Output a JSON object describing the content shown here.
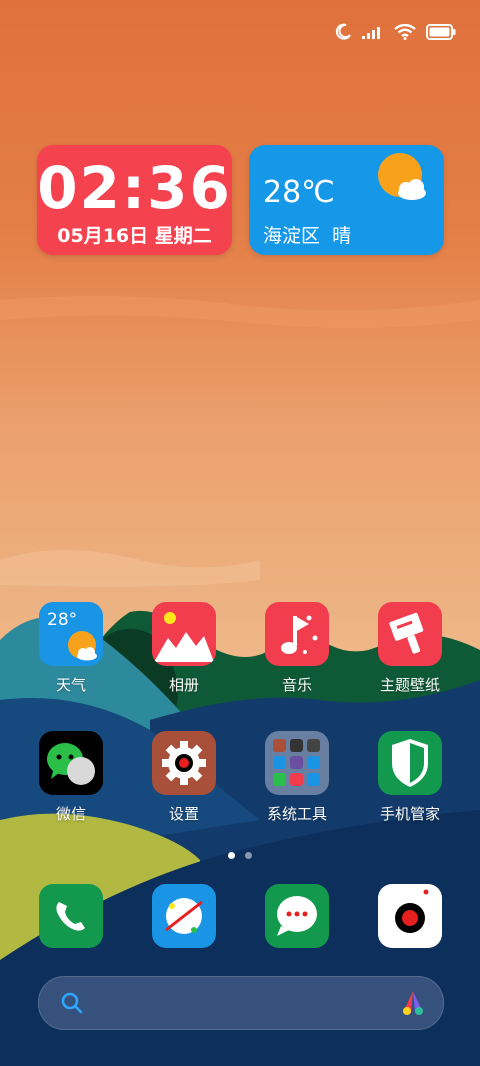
{
  "status_bar": {
    "icons": [
      "moon-icon",
      "signal-icon",
      "wifi-icon",
      "battery-icon"
    ]
  },
  "clock_widget": {
    "time": "02:36",
    "date": "05月16日 星期二"
  },
  "weather_widget": {
    "temperature": "28℃",
    "location": "海淀区",
    "condition": "晴",
    "icon": "sun-cloud-icon"
  },
  "apps": [
    {
      "label": "天气",
      "icon": "weather-app-icon",
      "badge": "28°"
    },
    {
      "label": "相册",
      "icon": "gallery-icon"
    },
    {
      "label": "音乐",
      "icon": "music-icon"
    },
    {
      "label": "主题壁纸",
      "icon": "themes-icon"
    },
    {
      "label": "微信",
      "icon": "wechat-icon"
    },
    {
      "label": "设置",
      "icon": "settings-gear-icon"
    },
    {
      "label": "系统工具",
      "icon": "folder-icon"
    },
    {
      "label": "手机管家",
      "icon": "security-shield-icon"
    }
  ],
  "page_indicator": {
    "pages": 2,
    "current": 1
  },
  "dock": [
    {
      "name": "phone",
      "icon": "phone-icon"
    },
    {
      "name": "browser",
      "icon": "browser-icon"
    },
    {
      "name": "messages",
      "icon": "message-icon"
    },
    {
      "name": "camera",
      "icon": "camera-icon"
    }
  ],
  "search_bar": {
    "icon": "search-icon",
    "assistant_icon": "assistant-icon"
  },
  "colors": {
    "clock_bg": "#f5424f",
    "weather_bg": "#1698e8",
    "accent_red": "#f5424f"
  }
}
